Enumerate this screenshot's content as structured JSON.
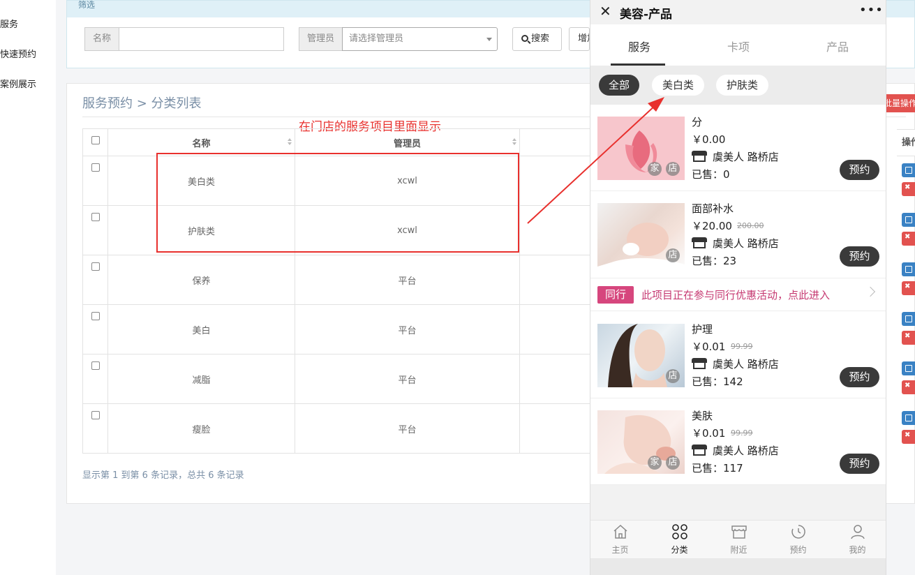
{
  "sidebar": {
    "items": [
      {
        "label": "服务"
      },
      {
        "label": "快速预约"
      },
      {
        "label": "案例展示"
      }
    ]
  },
  "filter": {
    "header": "筛选",
    "name_label": "名称",
    "name_value": "",
    "admin_label": "管理员",
    "admin_placeholder": "请选择管理员",
    "search_button": "搜索",
    "add_button": "增加"
  },
  "main": {
    "breadcrumb": "服务预约 > 分类列表",
    "annotation": "在门店的服务项目里面显示",
    "batch_button": "批量操作",
    "columns": [
      "名称",
      "管理员",
      "操作"
    ],
    "rows": [
      {
        "name": "美白类",
        "admin": "xcwl"
      },
      {
        "name": "护肤类",
        "admin": "xcwl"
      },
      {
        "name": "保养",
        "admin": "平台"
      },
      {
        "name": "美白",
        "admin": "平台"
      },
      {
        "name": "减脂",
        "admin": "平台"
      },
      {
        "name": "瘦脸",
        "admin": "平台"
      }
    ],
    "footer": "显示第 1 到第 6 条记录，总共 6 条记录"
  },
  "phone": {
    "title": "美容-产品",
    "close_icon": "close-icon",
    "more_icon": "more-icon",
    "tabs": [
      "服务",
      "卡项",
      "产品"
    ],
    "chips": [
      "全部",
      "美白类",
      "护肤类"
    ],
    "products": [
      {
        "name": "分",
        "price": "￥0.00",
        "original": "",
        "store": "虞美人 路桥店",
        "sold": "已售：0",
        "tags": [
          "家",
          "店"
        ],
        "book": "预约"
      },
      {
        "name": "面部补水",
        "price": "￥20.00",
        "original": "200.00",
        "store": "虞美人 路桥店",
        "sold": "已售：23",
        "tags": [
          "店"
        ],
        "book": "预约"
      },
      {
        "name": "护理",
        "price": "￥0.01",
        "original": "99.99",
        "store": "虞美人 路桥店",
        "sold": "已售：142",
        "tags": [
          "店"
        ],
        "book": "预约"
      },
      {
        "name": "美肤",
        "price": "￥0.01",
        "original": "99.99",
        "store": "虞美人 路桥店",
        "sold": "已售：117",
        "tags": [
          "家",
          "店"
        ],
        "book": "预约"
      }
    ],
    "promo": {
      "badge": "同行",
      "text": "此项目正在参与同行优惠活动，点此进入"
    },
    "nav": [
      {
        "label": "主页",
        "icon": "home-icon"
      },
      {
        "label": "分类",
        "icon": "grid-icon"
      },
      {
        "label": "附近",
        "icon": "store-icon"
      },
      {
        "label": "预约",
        "icon": "clock-icon"
      },
      {
        "label": "我的",
        "icon": "user-icon"
      }
    ]
  },
  "colors": {
    "accent_red": "#e8302d",
    "promo_pink": "#d6467d",
    "dark_chip": "#3a3a3a",
    "edit_blue": "#3a82c4"
  }
}
